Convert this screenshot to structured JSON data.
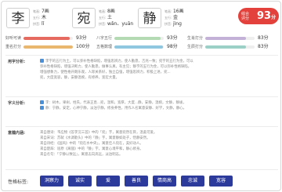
{
  "chars": [
    {
      "char": "李",
      "strokes_label": "笔画:",
      "strokes": "7画",
      "fivexing_label": "五行:",
      "fivexing": "木",
      "pinyin_label": "拼音:",
      "pinyin": "lǐ"
    },
    {
      "char": "宛",
      "strokes_label": "笔画:",
      "strokes": "8画",
      "fivexing_label": "五行:",
      "fivexing": "土",
      "pinyin_label": "拼音:",
      "pinyin": "wǎn、yuān"
    },
    {
      "char": "静",
      "strokes_label": "笔画:",
      "strokes": "16画",
      "fivexing_label": "五行:",
      "fivexing": "金",
      "pinyin_label": "拼音:",
      "pinyin": "jìng"
    }
  ],
  "score": {
    "label": "综合评分",
    "value": "93",
    "unit": "分",
    "color": "#e3413b"
  },
  "metrics": [
    {
      "label": "好听可读",
      "value": "93分",
      "pct": 0.93,
      "color": "#e66a60"
    },
    {
      "label": "八字五行",
      "value": "93分",
      "pct": 0.93,
      "color": "#b4dab4"
    },
    {
      "label": "生肖打分",
      "value": "83分",
      "pct": 0.83,
      "color": "#c4b1d8"
    },
    {
      "label": "重名打分",
      "value": "100分",
      "pct": 1.0,
      "color": "#e9b76d"
    },
    {
      "label": "五格数理",
      "value": "98分",
      "pct": 0.98,
      "color": "#8ec7df"
    },
    {
      "label": "生辰打分",
      "value": "83分",
      "pct": 0.83,
      "color": "#9ad0c6"
    }
  ],
  "sections": [
    {
      "title": "用字分析:",
      "lines": [
        "李字的五行为土，可以弥补性格缺陷，增强思辨力，使人勤恳，吉兆一致；宛字的五行为金，可以",
        "弥补性格缺陷，增强决断力，使人勤恳，做事认真，有主见；静字的五行为金，可以弥补性格缺陷，",
        "增强想象力，使性格开朗乐观，人际关系好，独立自强，增强思辨力，积极上进，宛...",
        "宛，大度宽容，静，安静温婉，有修养，宽宏大量。"
      ]
    },
    {
      "title": "字义分析:",
      "lines": [
        "李：树木，果树，姓氏，代表正直...宛，温和，宽厚，大度...静，安静，温婉，文静，静谧，",
        "静：宁静，安定，心神宁静，淡泊宁静，修身养性，用作人名寓意安静、好学，文静，静心。"
      ]
    },
    {
      "title": "意蕴内涵:",
      "lines": [
        "来自唐诗：韦应物《答李浣三首》中的「宛」字，寓意宛然在目，温柔可爱。",
        "来自宋词：苏轼《水调歌头》中的「静」字，寓意静如处子，恬静安然。",
        "来自诗经：《国风》中的「宛在水中央」，寓意佳人宛在，美好动人。",
        "来自楚辞：屈原《离骚》中的「静」字，寓意心境平和，静心修身。",
        "来自名句：「宁静以致远」，寓意志向高远，淡泊明志。"
      ]
    }
  ],
  "tags_label": "性格标签:",
  "tags": [
    "洞察力",
    "诚实",
    "爱",
    "善良",
    "情商高",
    "忠诚",
    "宽容"
  ]
}
